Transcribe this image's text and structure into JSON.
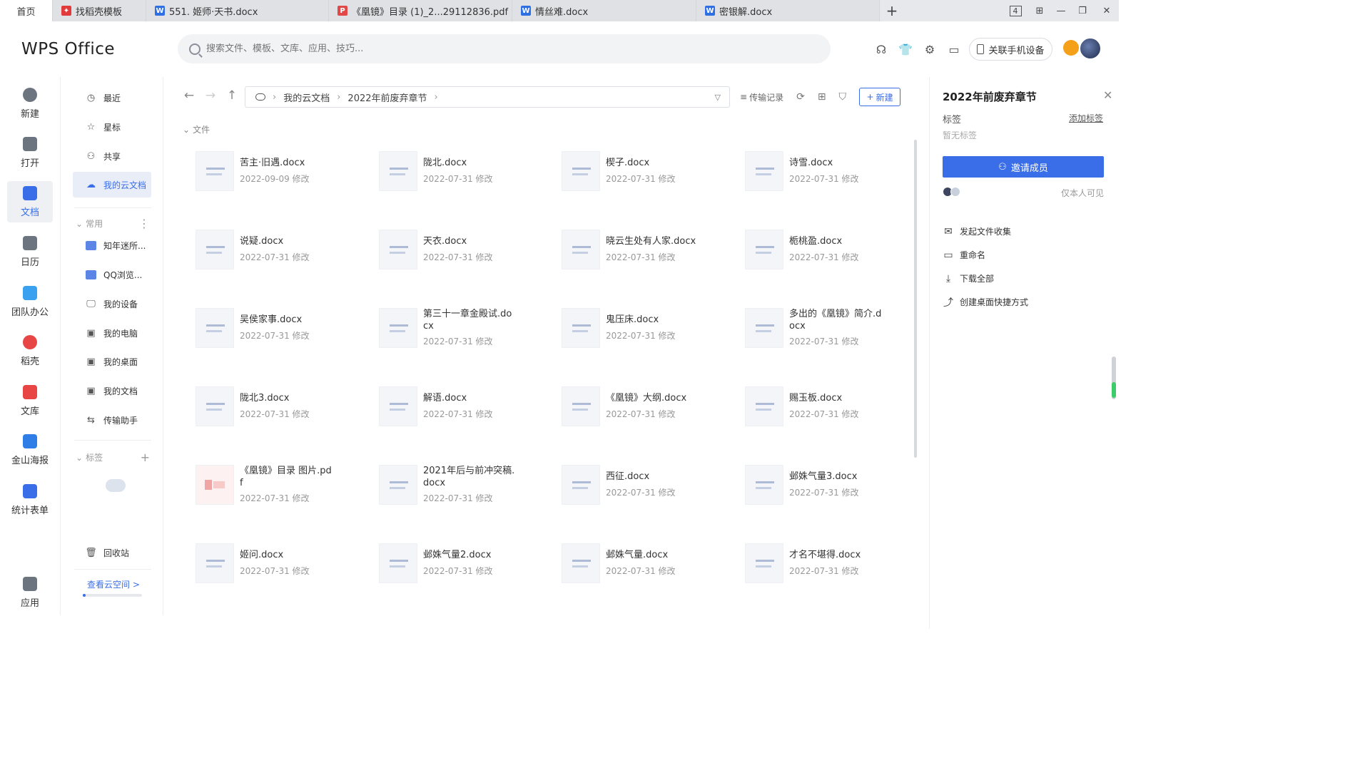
{
  "tabs": [
    {
      "label": "首页",
      "icon": "none"
    },
    {
      "label": "找稻壳模板",
      "icon": "docer-icon"
    },
    {
      "label": "551. 姬师·天书.docx",
      "icon": "word-icon"
    },
    {
      "label": "《凰镜》目录 (1)_2...29112836.pdf",
      "icon": "pdf-icon"
    },
    {
      "label": "情丝难.docx",
      "icon": "word-icon"
    },
    {
      "label": "密银解.docx",
      "icon": "word-icon"
    }
  ],
  "window_controls": {
    "badge": "4",
    "add": "+"
  },
  "header": {
    "logo": "WPS Office",
    "search_placeholder": "搜索文件、模板、文库、应用、技巧...",
    "link_phone": "关联手机设备"
  },
  "leftnav": [
    {
      "label": "新建",
      "icon": "plus-circle-icon"
    },
    {
      "label": "打开",
      "icon": "folder-icon"
    },
    {
      "label": "文档",
      "icon": "document-icon"
    },
    {
      "label": "日历",
      "icon": "calendar-icon"
    },
    {
      "label": "团队办公",
      "icon": "team-icon"
    },
    {
      "label": "稻壳",
      "icon": "docer-icon"
    },
    {
      "label": "文库",
      "icon": "library-icon"
    },
    {
      "label": "金山海报",
      "icon": "poster-icon"
    },
    {
      "label": "统计表单",
      "icon": "form-icon"
    },
    {
      "label": "应用",
      "icon": "apps-grid-icon"
    }
  ],
  "sidebar": {
    "items": [
      {
        "label": "最近",
        "icon": "clock-icon"
      },
      {
        "label": "星标",
        "icon": "star-icon"
      },
      {
        "label": "共享",
        "icon": "share-icon"
      },
      {
        "label": "我的云文档",
        "icon": "cloud-icon"
      }
    ],
    "common_title": "常用",
    "common": [
      {
        "label": "知年迷所...",
        "icon": "folder-icon"
      },
      {
        "label": "QQ浏览...",
        "icon": "folder-icon"
      },
      {
        "label": "我的设备",
        "icon": "device-icon"
      },
      {
        "label": "我的电脑",
        "icon": "computer-icon"
      },
      {
        "label": "我的桌面",
        "icon": "desktop-icon"
      },
      {
        "label": "我的文档",
        "icon": "doc-folder-icon"
      },
      {
        "label": "传输助手",
        "icon": "transfer-icon"
      }
    ],
    "tags_title": "标签",
    "recycle": "回收站",
    "cloud_space": "查看云空间 >",
    "space_used": 0.05
  },
  "crumb": {
    "root": "我的云文档",
    "folder": "2022年前废弃章节"
  },
  "toolbar": {
    "transfer": "传输记录",
    "new": "新建"
  },
  "section_label": "文件",
  "files": [
    {
      "name": "苦主·旧遇.docx",
      "date": "2022-09-09 修改",
      "type": "doc"
    },
    {
      "name": "陇北.docx",
      "date": "2022-07-31 修改",
      "type": "doc"
    },
    {
      "name": "楔子.docx",
      "date": "2022-07-31 修改",
      "type": "doc"
    },
    {
      "name": "诗雪.docx",
      "date": "2022-07-31 修改",
      "type": "doc"
    },
    {
      "name": "说疑.docx",
      "date": "2022-07-31 修改",
      "type": "doc"
    },
    {
      "name": "天衣.docx",
      "date": "2022-07-31 修改",
      "type": "doc"
    },
    {
      "name": "晓云生处有人家.docx",
      "date": "2022-07-31 修改",
      "type": "doc"
    },
    {
      "name": "栀桃盈.docx",
      "date": "2022-07-31 修改",
      "type": "doc"
    },
    {
      "name": "吴侯家事.docx",
      "date": "2022-07-31 修改",
      "type": "doc"
    },
    {
      "name": "第三十一章金殿试.docx",
      "date": "2022-07-31 修改",
      "type": "doc"
    },
    {
      "name": "鬼压床.docx",
      "date": "2022-07-31 修改",
      "type": "doc"
    },
    {
      "name": "多出的《凰镜》简介.docx",
      "date": "2022-07-31 修改",
      "type": "doc"
    },
    {
      "name": "陇北3.docx",
      "date": "2022-07-31 修改",
      "type": "doc"
    },
    {
      "name": "解语.docx",
      "date": "2022-07-31 修改",
      "type": "doc"
    },
    {
      "name": "《凰镜》大纲.docx",
      "date": "2022-07-31 修改",
      "type": "doc"
    },
    {
      "name": "赐玉板.docx",
      "date": "2022-07-31 修改",
      "type": "doc"
    },
    {
      "name": "《凰镜》目录 图片.pdf",
      "date": "2022-07-31 修改",
      "type": "pdf"
    },
    {
      "name": "2021年后与前冲突稿.docx",
      "date": "2022-07-31 修改",
      "type": "doc"
    },
    {
      "name": "西征.docx",
      "date": "2022-07-31 修改",
      "type": "doc"
    },
    {
      "name": "邺姝气量3.docx",
      "date": "2022-07-31 修改",
      "type": "doc"
    },
    {
      "name": "姬问.docx",
      "date": "2022-07-31 修改",
      "type": "doc"
    },
    {
      "name": "邺姝气量2.docx",
      "date": "2022-07-31 修改",
      "type": "doc"
    },
    {
      "name": "邺姝气量.docx",
      "date": "2022-07-31 修改",
      "type": "doc"
    },
    {
      "name": "才名不堪得.docx",
      "date": "2022-07-31 修改",
      "type": "doc"
    }
  ],
  "panel": {
    "title": "2022年前废弃章节",
    "tag_label": "标签",
    "add_tag": "添加标签",
    "no_tag": "暂无标签",
    "invite": "邀请成员",
    "visibility": "仅本人可见",
    "actions": [
      {
        "label": "发起文件收集",
        "icon": "collect-icon"
      },
      {
        "label": "重命名",
        "icon": "rename-icon"
      },
      {
        "label": "下载全部",
        "icon": "download-icon"
      },
      {
        "label": "创建桌面快捷方式",
        "icon": "shortcut-icon"
      }
    ]
  },
  "colors": {
    "accent": "#3a6ee8",
    "active_bg": "#e8edf7"
  }
}
